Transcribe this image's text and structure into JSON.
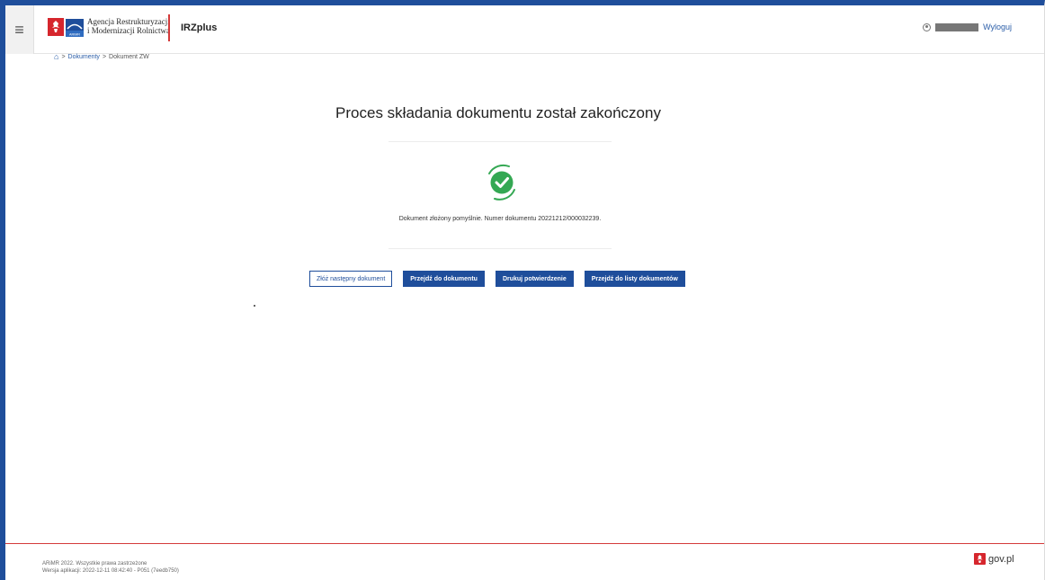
{
  "header": {
    "menu_icon": "hamburger-icon",
    "org_name_line1": "Agencja Restrukturyzacji",
    "org_name_line2": "i Modernizacji Rolnictwa",
    "arimr_logo_text": "ARiMR",
    "app_name": "IRZplus",
    "user_icon": "user-icon",
    "logout_label": "Wyloguj",
    "accent_color": "#1f4e9b",
    "separator_color": "#d43a3a"
  },
  "breadcrumb": {
    "home_icon": "home-icon",
    "separator": ">",
    "items": [
      "Dokumenty",
      "Dokument ZW"
    ]
  },
  "main": {
    "title": "Proces składania dokumentu został zakończony",
    "status_icon": "check-circle-icon",
    "status_color": "#34a853",
    "message": "Dokument złożony pomyślnie. Numer dokumentu 20221212/000032239.",
    "buttons": [
      {
        "label": "Złóż następny dokument",
        "style": "outline"
      },
      {
        "label": "Przejdź do dokumentu",
        "style": "primary"
      },
      {
        "label": "Drukuj potwierdzenie",
        "style": "primary"
      },
      {
        "label": "Przejdź do listy dokumentów",
        "style": "primary"
      }
    ]
  },
  "footer": {
    "copyright": "ARiMR 2022. Wszystkie prawa zastrzeżone",
    "version": "Wersja aplikacji: 2022-12-11 08:42:40 - P051 (7eedb750)",
    "govpl_label": "gov.pl"
  }
}
